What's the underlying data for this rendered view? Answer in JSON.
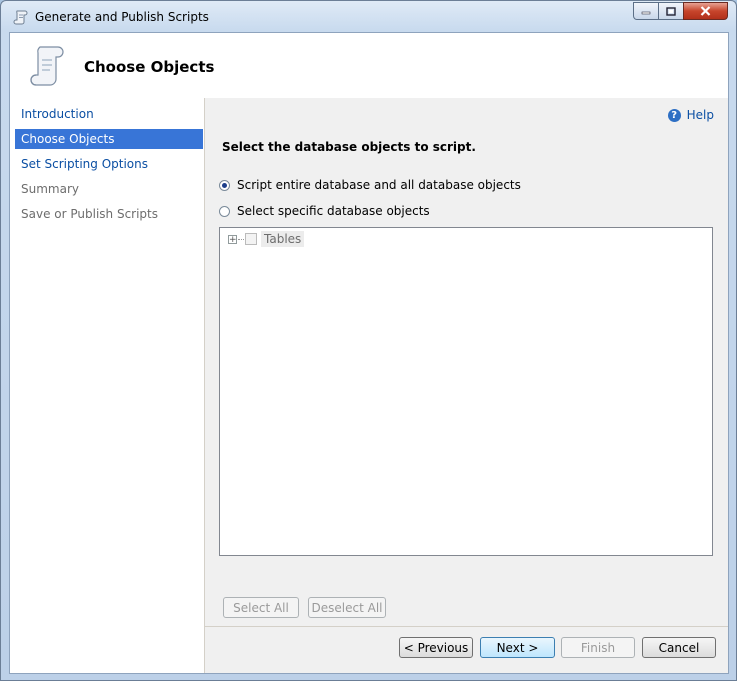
{
  "window": {
    "title": "Generate and Publish Scripts",
    "caption_buttons": [
      "minimize-icon",
      "maximize-icon",
      "close-icon"
    ]
  },
  "header": {
    "title": "Choose Objects",
    "icon": "scroll-icon"
  },
  "nav": {
    "items": [
      {
        "label": "Introduction",
        "state": "link"
      },
      {
        "label": "Choose Objects",
        "state": "active"
      },
      {
        "label": "Set Scripting Options",
        "state": "link"
      },
      {
        "label": "Summary",
        "state": "disabled"
      },
      {
        "label": "Save or Publish Scripts",
        "state": "disabled"
      }
    ]
  },
  "main": {
    "help_label": "Help",
    "instruction": "Select the database objects to script.",
    "options": [
      {
        "label": "Script entire database and all database objects",
        "selected": true
      },
      {
        "label": "Select specific database objects",
        "selected": false
      }
    ],
    "tree": {
      "items": [
        {
          "label": "Tables",
          "checked": false,
          "expanded": false
        }
      ]
    },
    "select_all_label": "Select All",
    "deselect_all_label": "Deselect All"
  },
  "footer": {
    "previous_label": "< Previous",
    "next_label": "Next >",
    "finish_label": "Finish",
    "cancel_label": "Cancel"
  },
  "colors": {
    "accent": "#3875d7",
    "link": "#0b4fa3",
    "panel": "#f0f0f0"
  }
}
